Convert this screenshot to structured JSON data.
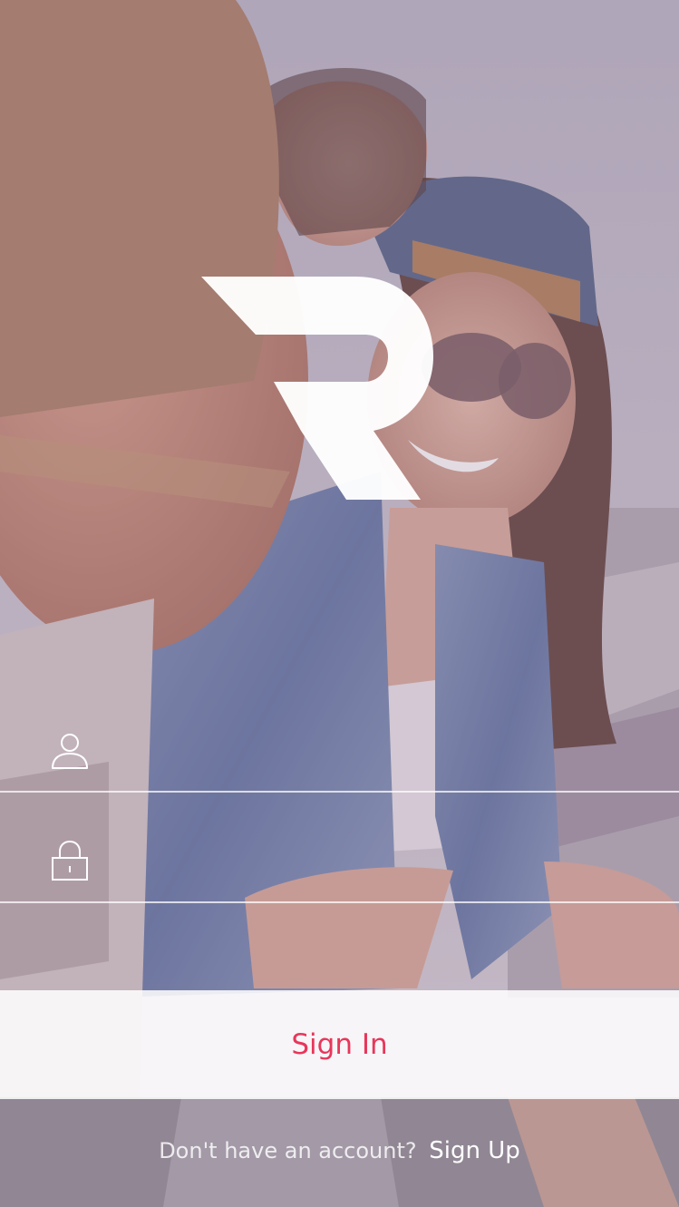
{
  "brand": {
    "logo_icon": "r-logo-icon",
    "logo_color": "#ffffff"
  },
  "form": {
    "username": {
      "icon": "user-icon",
      "value": "",
      "placeholder": ""
    },
    "password": {
      "icon": "lock-icon",
      "value": "",
      "placeholder": ""
    }
  },
  "signin": {
    "label": "Sign In",
    "color": "#e8365b"
  },
  "footer": {
    "prompt": "Don't have an account?",
    "signup_label": "Sign Up"
  }
}
